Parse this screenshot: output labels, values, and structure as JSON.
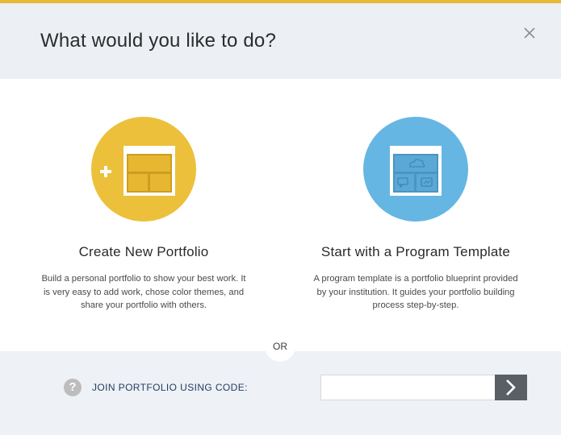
{
  "dialog": {
    "title": "What would you like to do?",
    "close_icon": "close-icon"
  },
  "options": [
    {
      "title": "Create New Portfolio",
      "description": "Build a personal portfolio to show your best work. It is very easy to add work, chose color themes, and share your portfolio with others.",
      "icon": "new-portfolio-icon",
      "color": "#ecc03a"
    },
    {
      "title": "Start with a Program Template",
      "description": "A program template is a portfolio blueprint provided by your institution. It guides your portfolio building process step-by-step.",
      "icon": "program-template-icon",
      "color": "#66b6e3"
    }
  ],
  "divider": {
    "label": "OR"
  },
  "join": {
    "help_icon": "?",
    "label": "JOIN PORTFOLIO USING CODE:",
    "input_value": "",
    "input_placeholder": "",
    "submit_icon": "chevron-right-icon"
  },
  "colors": {
    "accent_stripe": "#e8b838",
    "header_bg": "#eceff3",
    "footer_bg": "#eef1f5",
    "submit_bg": "#5a5f66"
  }
}
